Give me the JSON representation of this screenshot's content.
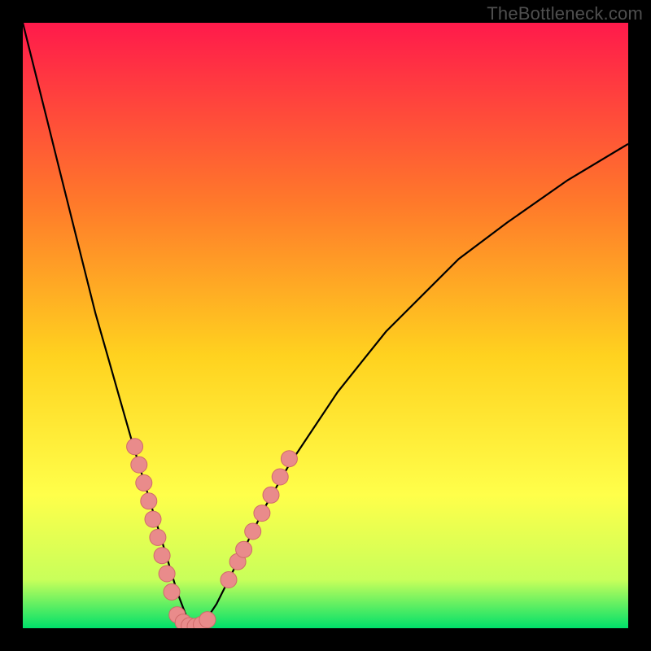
{
  "watermark": "TheBottleneck.com",
  "colors": {
    "frame_bg": "#000000",
    "grad_top": "#ff1a4b",
    "grad_mid1": "#ff7a2a",
    "grad_mid2": "#ffd21f",
    "grad_mid3": "#ffff4a",
    "grad_low": "#c8ff5a",
    "grad_bottom": "#00e06a",
    "curve": "#000000",
    "dot_fill": "#e98b8b",
    "dot_stroke": "#d06a6a"
  },
  "chart_data": {
    "type": "line",
    "title": "",
    "xlabel": "",
    "ylabel": "",
    "xlim": [
      0,
      100
    ],
    "ylim": [
      0,
      100
    ],
    "series": [
      {
        "name": "bottleneck-curve",
        "x": [
          0,
          2,
          4,
          6,
          8,
          10,
          12,
          14,
          16,
          18,
          19.5,
          21,
          22.5,
          24,
          25.5,
          27,
          28.5,
          30,
          32,
          34,
          36,
          38,
          40,
          44,
          48,
          52,
          56,
          60,
          66,
          72,
          80,
          90,
          100
        ],
        "y": [
          100,
          92,
          84,
          76,
          68,
          60,
          52,
          45,
          38,
          31,
          26,
          21,
          16,
          11,
          6,
          2,
          0,
          1,
          4,
          8,
          12,
          16,
          20,
          27,
          33,
          39,
          44,
          49,
          55,
          61,
          67,
          74,
          80
        ]
      }
    ],
    "points": [
      {
        "name": "left-cluster-dot",
        "x": 18.5,
        "y": 30
      },
      {
        "name": "left-cluster-dot",
        "x": 19.2,
        "y": 27
      },
      {
        "name": "left-cluster-dot",
        "x": 20.0,
        "y": 24
      },
      {
        "name": "left-cluster-dot",
        "x": 20.8,
        "y": 21
      },
      {
        "name": "left-cluster-dot",
        "x": 21.5,
        "y": 18
      },
      {
        "name": "left-cluster-dot",
        "x": 22.3,
        "y": 15
      },
      {
        "name": "left-cluster-dot",
        "x": 23.0,
        "y": 12
      },
      {
        "name": "left-cluster-dot",
        "x": 23.8,
        "y": 9
      },
      {
        "name": "left-cluster-dot",
        "x": 24.6,
        "y": 6
      },
      {
        "name": "bottom-cluster-dot",
        "x": 25.5,
        "y": 2.2
      },
      {
        "name": "bottom-cluster-dot",
        "x": 26.5,
        "y": 1.0
      },
      {
        "name": "bottom-cluster-dot",
        "x": 27.5,
        "y": 0.4
      },
      {
        "name": "bottom-cluster-dot",
        "x": 28.5,
        "y": 0.3
      },
      {
        "name": "bottom-cluster-dot",
        "x": 29.5,
        "y": 0.6
      },
      {
        "name": "bottom-cluster-dot",
        "x": 30.5,
        "y": 1.4
      },
      {
        "name": "right-cluster-dot",
        "x": 34.0,
        "y": 8
      },
      {
        "name": "right-cluster-dot",
        "x": 35.5,
        "y": 11
      },
      {
        "name": "right-cluster-dot",
        "x": 36.5,
        "y": 13
      },
      {
        "name": "right-cluster-dot",
        "x": 38.0,
        "y": 16
      },
      {
        "name": "right-cluster-dot",
        "x": 39.5,
        "y": 19
      },
      {
        "name": "right-cluster-dot",
        "x": 41.0,
        "y": 22
      },
      {
        "name": "right-cluster-dot",
        "x": 42.5,
        "y": 25
      },
      {
        "name": "right-cluster-dot",
        "x": 44.0,
        "y": 28
      }
    ]
  }
}
